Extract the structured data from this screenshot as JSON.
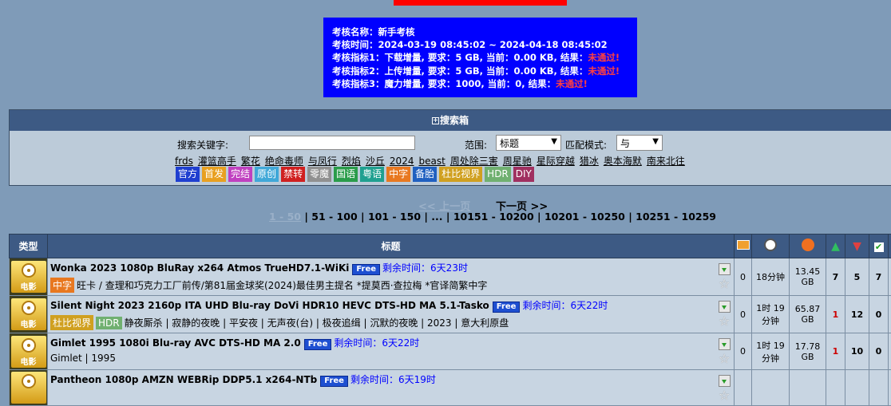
{
  "exam": {
    "lines": [
      {
        "text": "考核名称：新手考核",
        "result": ""
      },
      {
        "text": "考核时间：2024-03-19 08:45:02 ~ 2024-04-18 08:45:02",
        "result": ""
      },
      {
        "text": "考核指标1：下载增量, 要求：5 GB, 当前：0.00 KB, 结果：",
        "result": "未通过!"
      },
      {
        "text": "考核指标2：上传增量, 要求：5 GB, 当前：0.00 KB, 结果：",
        "result": "未通过!"
      },
      {
        "text": "考核指标3：魔力增量, 要求：1000, 当前：0, 结果：",
        "result": "未通过!"
      }
    ]
  },
  "search": {
    "header": "搜索箱",
    "keyword_label": "搜索关键字:",
    "keyword_value": "",
    "scope_label": "范围:",
    "scope_value": "标题",
    "match_label": "匹配模式:",
    "match_value": "与",
    "hot_keywords": [
      "frds",
      "灌篮高手",
      "繁花",
      "绝命毒师",
      "与凤行",
      "烈焰",
      "沙丘",
      "2024",
      "beast",
      "周处除三害",
      "周星驰",
      "星际穿越",
      "猎冰",
      "奥本海默",
      "南来北往"
    ],
    "tags": [
      {
        "label": "官方",
        "color": "#1f3fd0"
      },
      {
        "label": "首发",
        "color": "#e8a020"
      },
      {
        "label": "完结",
        "color": "#c040c0"
      },
      {
        "label": "原创",
        "color": "#40a8d8"
      },
      {
        "label": "禁转",
        "color": "#d02020"
      },
      {
        "label": "零魔",
        "color": "#909090"
      },
      {
        "label": "国语",
        "color": "#2a9c4a"
      },
      {
        "label": "粤语",
        "color": "#20a090"
      },
      {
        "label": "中字",
        "color": "#e87820"
      },
      {
        "label": "备胎",
        "color": "#2060c0"
      },
      {
        "label": "杜比视界",
        "color": "#d0a020"
      },
      {
        "label": "HDR",
        "color": "#70b070"
      },
      {
        "label": "DIY",
        "color": "#a03060"
      }
    ]
  },
  "pager": {
    "prev": "<< 上一页",
    "next": "下一页 >>",
    "current": "1 - 50",
    "pages": [
      "51 - 100",
      "101 - 150",
      "...",
      "10151 - 10200",
      "10201 - 10250",
      "10251 - 10259"
    ]
  },
  "table": {
    "col_type": "类型",
    "col_title": "标题",
    "rows": [
      {
        "category": "电影",
        "title": "Wonka 2023 1080p BluRay x264 Atmos TrueHD7.1-WiKi",
        "free": "Free",
        "remain": "剩余时间：6天23时",
        "tags": [
          {
            "label": "中字",
            "color": "#e87820"
          }
        ],
        "subtitle": "旺卡 / 查理和巧克力工厂前传/第81届金球奖(2024)最佳男主提名 *提莫西·查拉梅 *官译简繁中字",
        "comments": "0",
        "time": "18分钟",
        "size": "13.45 GB",
        "seeders": "7",
        "leechers": "5",
        "completed": "7",
        "seed_red": false
      },
      {
        "category": "电影",
        "title": "Silent Night 2023 2160p ITA UHD Blu-ray DoVi HDR10 HEVC DTS-HD MA 5.1-Tasko",
        "free": "Free",
        "remain": "剩余时间：6天22时",
        "tags": [
          {
            "label": "杜比视界",
            "color": "#d0a020"
          },
          {
            "label": "HDR",
            "color": "#70b070"
          }
        ],
        "subtitle": "静夜厮杀 | 寂静的夜晚 | 平安夜 | 无声夜(台) | 极夜追缉 | 沉默的夜晚 | 2023 | 意大利原盘",
        "comments": "0",
        "time": "1时 19分钟",
        "size": "65.87 GB",
        "seeders": "1",
        "leechers": "12",
        "completed": "0",
        "seed_red": true
      },
      {
        "category": "电影",
        "title": "Gimlet 1995 1080i Blu-ray AVC DTS-HD MA 2.0",
        "free": "Free",
        "remain": "剩余时间：6天22时",
        "tags": [],
        "subtitle": "Gimlet | 1995",
        "comments": "0",
        "time": "1时 19分钟",
        "size": "17.78 GB",
        "seeders": "1",
        "leechers": "10",
        "completed": "0",
        "seed_red": true
      },
      {
        "category": "",
        "title": "Pantheon 1080p AMZN WEBRip DDP5.1 x264-NTb",
        "free": "Free",
        "remain": "剩余时间：6天19时",
        "tags": [],
        "subtitle": "",
        "comments": "",
        "time": "",
        "size": "",
        "seeders": "",
        "leechers": "",
        "completed": "",
        "seed_red": false
      }
    ]
  }
}
